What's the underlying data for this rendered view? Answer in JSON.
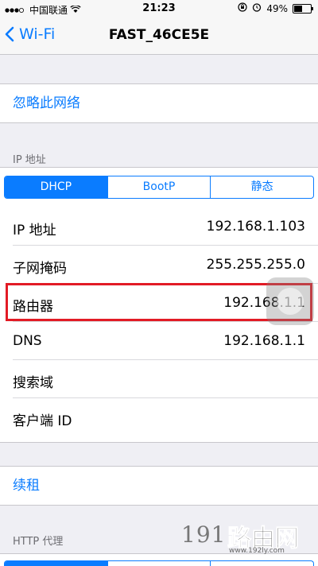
{
  "status_bar": {
    "carrier": "中国联通",
    "time": "21:23",
    "battery_text": "49%",
    "battery_level": 0.49
  },
  "nav": {
    "back_label": "Wi-Fi",
    "title": "FAST_46CE5E"
  },
  "forget_network": "忽略此网络",
  "ip_section": {
    "header": "IP 地址",
    "tabs": [
      "DHCP",
      "BootP",
      "静态"
    ],
    "active_tab": "DHCP",
    "rows": [
      {
        "label": "IP 地址",
        "value": "192.168.1.103"
      },
      {
        "label": "子网掩码",
        "value": "255.255.255.0"
      },
      {
        "label": "路由器",
        "value": "192.168.1.1"
      },
      {
        "label": "DNS",
        "value": "192.168.1.1"
      },
      {
        "label": "搜索域",
        "value": ""
      },
      {
        "label": "客户端 ID",
        "value": ""
      }
    ]
  },
  "renew_lease": "续租",
  "http_proxy": {
    "header": "HTTP 代理"
  },
  "watermark": {
    "number": "191",
    "text": "路由网",
    "url": "www.192ly.com"
  },
  "colors": {
    "accent": "#0a7cff",
    "highlight": "#e21b25",
    "background": "#efeff4"
  }
}
